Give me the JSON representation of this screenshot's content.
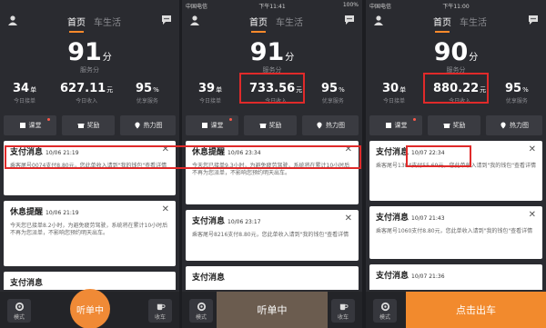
{
  "colors": {
    "accent": "#f08a36",
    "highlight_box": "#e02a2a",
    "badge": "#ff5a4a"
  },
  "icons": [
    "user-icon",
    "message-icon",
    "book-icon",
    "gift-icon",
    "location-pin-icon",
    "gear-icon",
    "coffee-cup-icon",
    "close-icon"
  ],
  "phones": [
    {
      "status": {
        "carrier": "",
        "time": "",
        "battery": ""
      },
      "tabs": {
        "home": "首页",
        "life": "车生活"
      },
      "score": {
        "value": "91",
        "unit": "分",
        "label": "服务分"
      },
      "stats": [
        {
          "value": "34",
          "unit": "单",
          "label": "今日接单"
        },
        {
          "value": "627.11",
          "unit": "元",
          "label": "今日收入"
        },
        {
          "value": "95",
          "unit": "%",
          "label": "优享服务"
        }
      ],
      "actions": {
        "class": "课堂",
        "reward": "奖励",
        "heatmap": "热力图"
      },
      "cards": [
        {
          "title": "支付消息",
          "date": "10/06 21:19",
          "body": "乘客尾号0074支付8.80元，您此单收入请到\"我的钱包\"查看详情"
        },
        {
          "title": "休息提醒",
          "date": "10/06 21:19",
          "body": "今天您已接单8.2小时，为避免疲劳驾驶，系统将在累计10小时后不再为您派单，不影响您预约明天出车。"
        },
        {
          "title": "支付消息",
          "date": "",
          "body": ""
        }
      ],
      "bottom": {
        "mode": "模式",
        "collect": "收车",
        "main": "听单中"
      }
    },
    {
      "status": {
        "carrier": "中国电信",
        "time": "下午11:41",
        "battery": "100%"
      },
      "tabs": {
        "home": "首页",
        "life": "车生活"
      },
      "score": {
        "value": "91",
        "unit": "分",
        "label": "服务分"
      },
      "stats": [
        {
          "value": "39",
          "unit": "单",
          "label": "今日接单"
        },
        {
          "value": "733.56",
          "unit": "元",
          "label": "今日收入"
        },
        {
          "value": "95",
          "unit": "%",
          "label": "优享服务"
        }
      ],
      "actions": {
        "class": "课堂",
        "reward": "奖励",
        "heatmap": "热力图"
      },
      "cards": [
        {
          "title": "休息提醒",
          "date": "10/06 23:34",
          "body": "今天您已接单9.3小时，为避免疲劳驾驶，系统将在累计10小时后不再为您派单，不影响您预约明天出车。"
        },
        {
          "title": "支付消息",
          "date": "10/06 23:17",
          "body": "乘客尾号8216支付8.80元，您此单收入请到\"我的钱包\"查看详情"
        },
        {
          "title": "支付消息",
          "date": "",
          "body": ""
        }
      ],
      "bottom": {
        "mode": "模式",
        "collect": "收车",
        "main": "听单中"
      }
    },
    {
      "status": {
        "carrier": "中国电信",
        "time": "下午11:00",
        "battery": ""
      },
      "tabs": {
        "home": "首页",
        "life": "车生活"
      },
      "score": {
        "value": "90",
        "unit": "分",
        "label": "服务分"
      },
      "stats": [
        {
          "value": "30",
          "unit": "单",
          "label": "今日接单"
        },
        {
          "value": "880.22",
          "unit": "元",
          "label": "今日收入"
        },
        {
          "value": "95",
          "unit": "%",
          "label": "优享服务"
        }
      ],
      "actions": {
        "class": "课堂",
        "reward": "奖励",
        "heatmap": "热力图"
      },
      "cards": [
        {
          "title": "支付消息",
          "date": "10/07 22:34",
          "body": "乘客尾号1384支付55.69元，您此单收入请到\"我的钱包\"查看详情"
        },
        {
          "title": "支付消息",
          "date": "10/07 21:43",
          "body": "乘客尾号1060支付8.80元，您此单收入请到\"我的钱包\"查看详情"
        },
        {
          "title": "支付消息",
          "date": "10/07 21:36",
          "body": ""
        }
      ],
      "bottom": {
        "mode": "模式",
        "collect": "",
        "main": "点击出车"
      }
    }
  ]
}
